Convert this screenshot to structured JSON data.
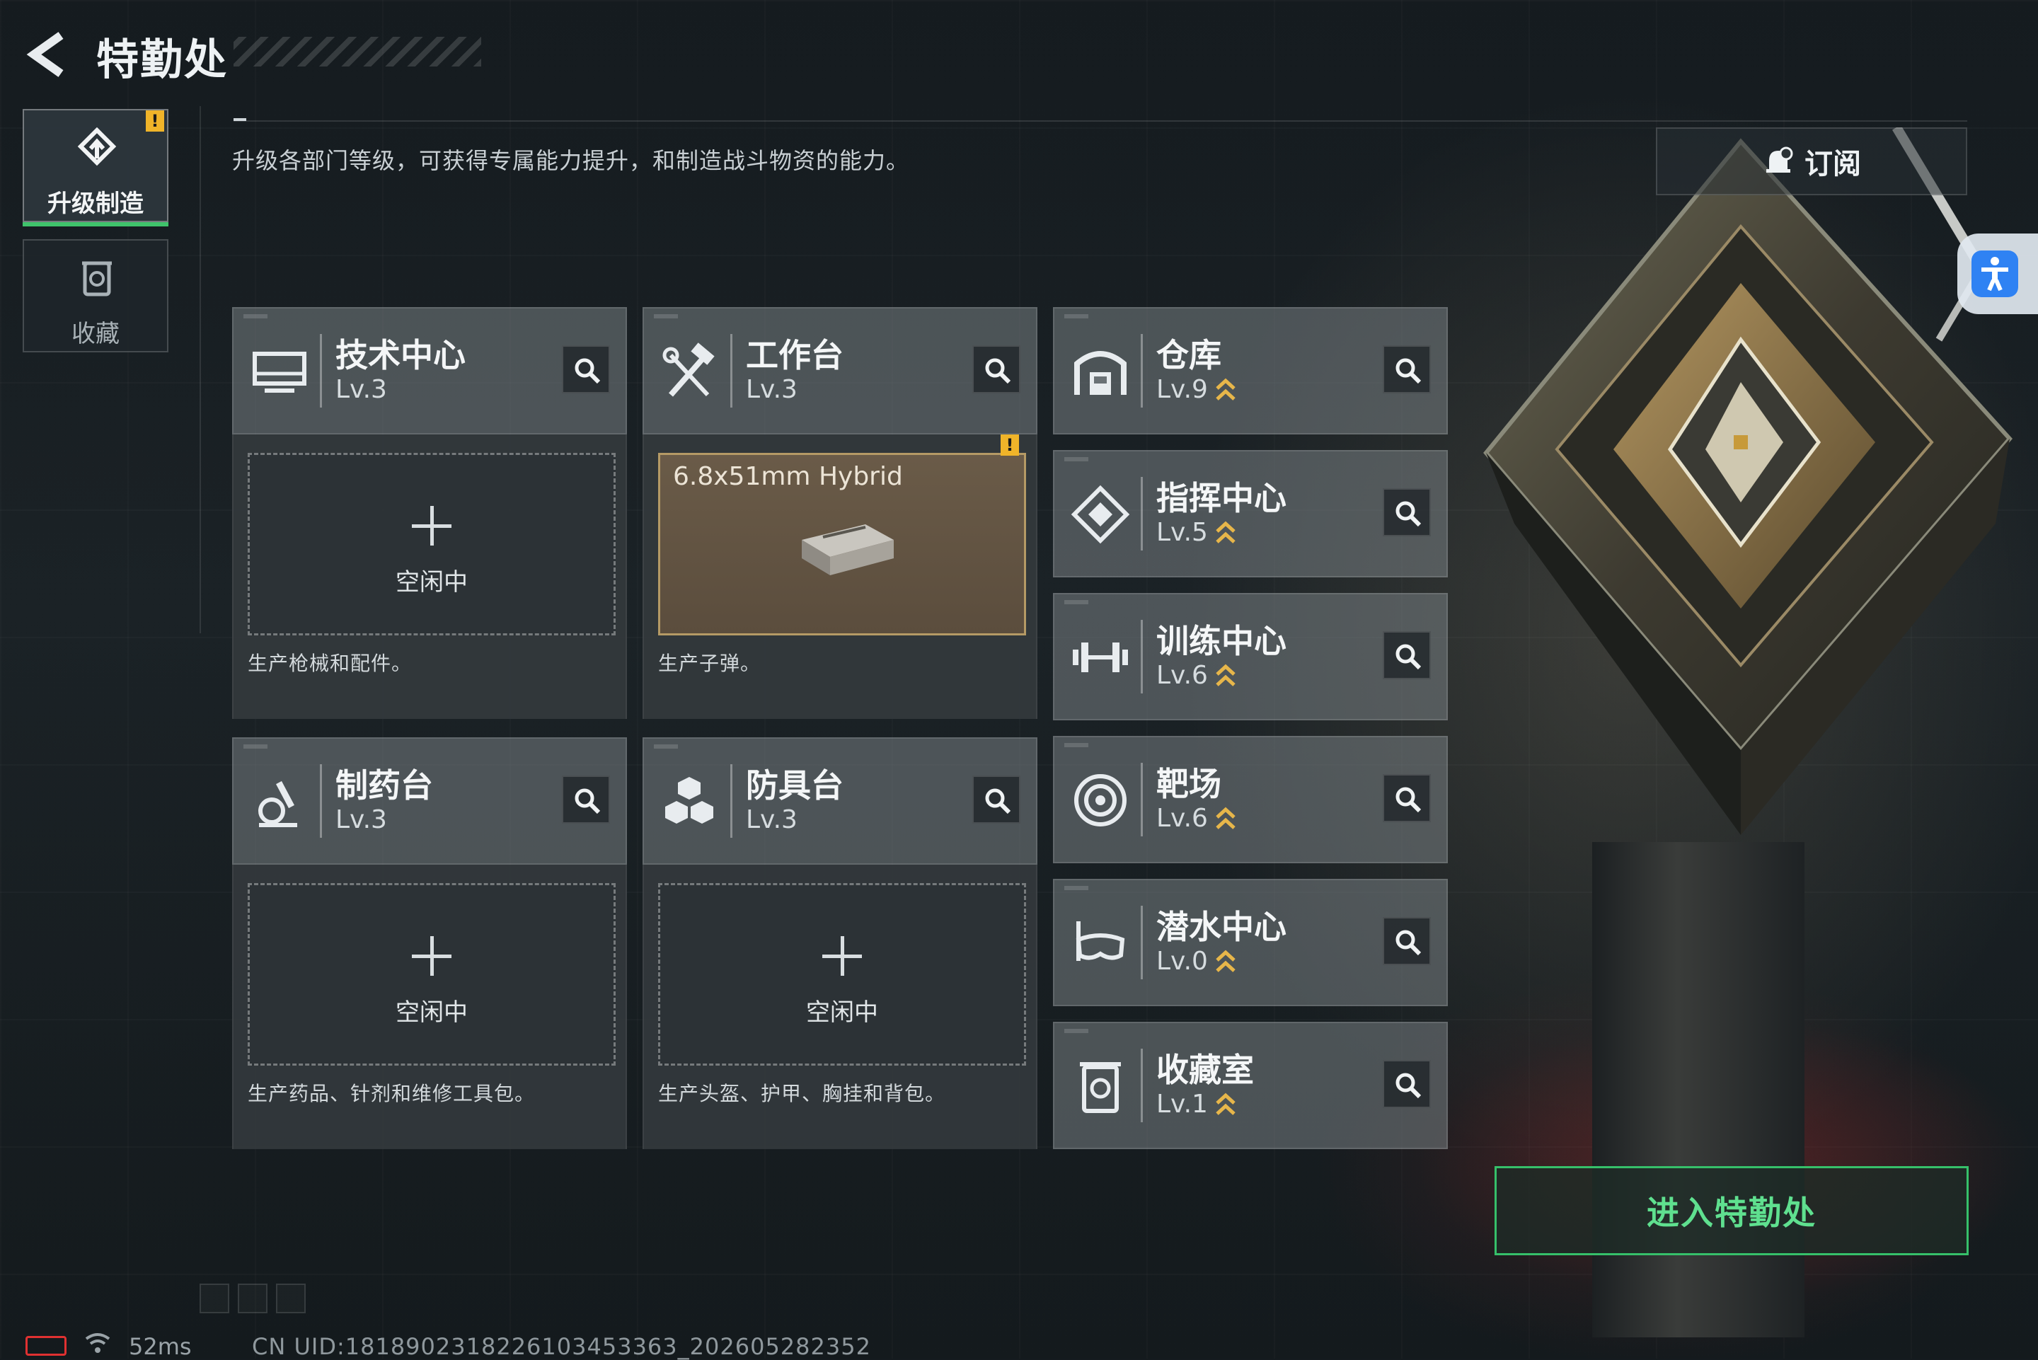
{
  "header": {
    "title": "特勤处",
    "description": "升级各部门等级，可获得专属能力提升，和制造战斗物资的能力。"
  },
  "side_tabs": [
    {
      "label": "升级制造",
      "icon": "upgrade-craft-icon",
      "active": true,
      "alert": "!"
    },
    {
      "label": "收藏",
      "icon": "collection-jar-icon",
      "active": false
    }
  ],
  "subscribe": {
    "label": "订阅",
    "icon": "bell-icon"
  },
  "stations": {
    "tech_center": {
      "name": "技术中心",
      "level": "Lv.3",
      "icon": "monitor-icon",
      "slot_label": "空闲中",
      "desc": "生产枪械和配件。"
    },
    "workbench": {
      "name": "工作台",
      "level": "Lv.3",
      "icon": "hammer-wrench-icon",
      "slot_item": "6.8x51mm Hybrid",
      "alert": "!",
      "desc": "生产子弹。"
    },
    "pharmacy": {
      "name": "制药台",
      "level": "Lv.3",
      "icon": "microscope-icon",
      "slot_label": "空闲中",
      "desc": "生产药品、针剂和维修工具包。"
    },
    "armor_bench": {
      "name": "防具台",
      "level": "Lv.3",
      "icon": "armor-blocks-icon",
      "slot_label": "空闲中",
      "desc": "生产头盔、护甲、胸挂和背包。"
    },
    "warehouse": {
      "name": "仓库",
      "level": "Lv.9",
      "icon": "storage-icon",
      "upgradable": true
    },
    "command_center": {
      "name": "指挥中心",
      "level": "Lv.5",
      "icon": "diamond-target-icon",
      "upgradable": true
    },
    "training_center": {
      "name": "训练中心",
      "level": "Lv.6",
      "icon": "dumbbell-icon",
      "upgradable": true
    },
    "shooting_range": {
      "name": "靶场",
      "level": "Lv.6",
      "icon": "target-icon",
      "upgradable": true
    },
    "diving_center": {
      "name": "潜水中心",
      "level": "Lv.0",
      "icon": "diving-mask-icon",
      "upgradable": true
    },
    "collection_room": {
      "name": "收藏室",
      "level": "Lv.1",
      "icon": "collection-jar-icon",
      "upgradable": true
    }
  },
  "enter_button": {
    "label": "进入特勤处"
  },
  "status": {
    "ping": "52ms",
    "uid": "CN UID:1818902318226103453363_202605282352"
  },
  "colors": {
    "accent_green": "#3fc36b",
    "alert_yellow": "#f0b429",
    "upgrade_gold": "#e7b64a",
    "accessibility_blue": "#2f82f3",
    "battery_red": "#e03131"
  }
}
